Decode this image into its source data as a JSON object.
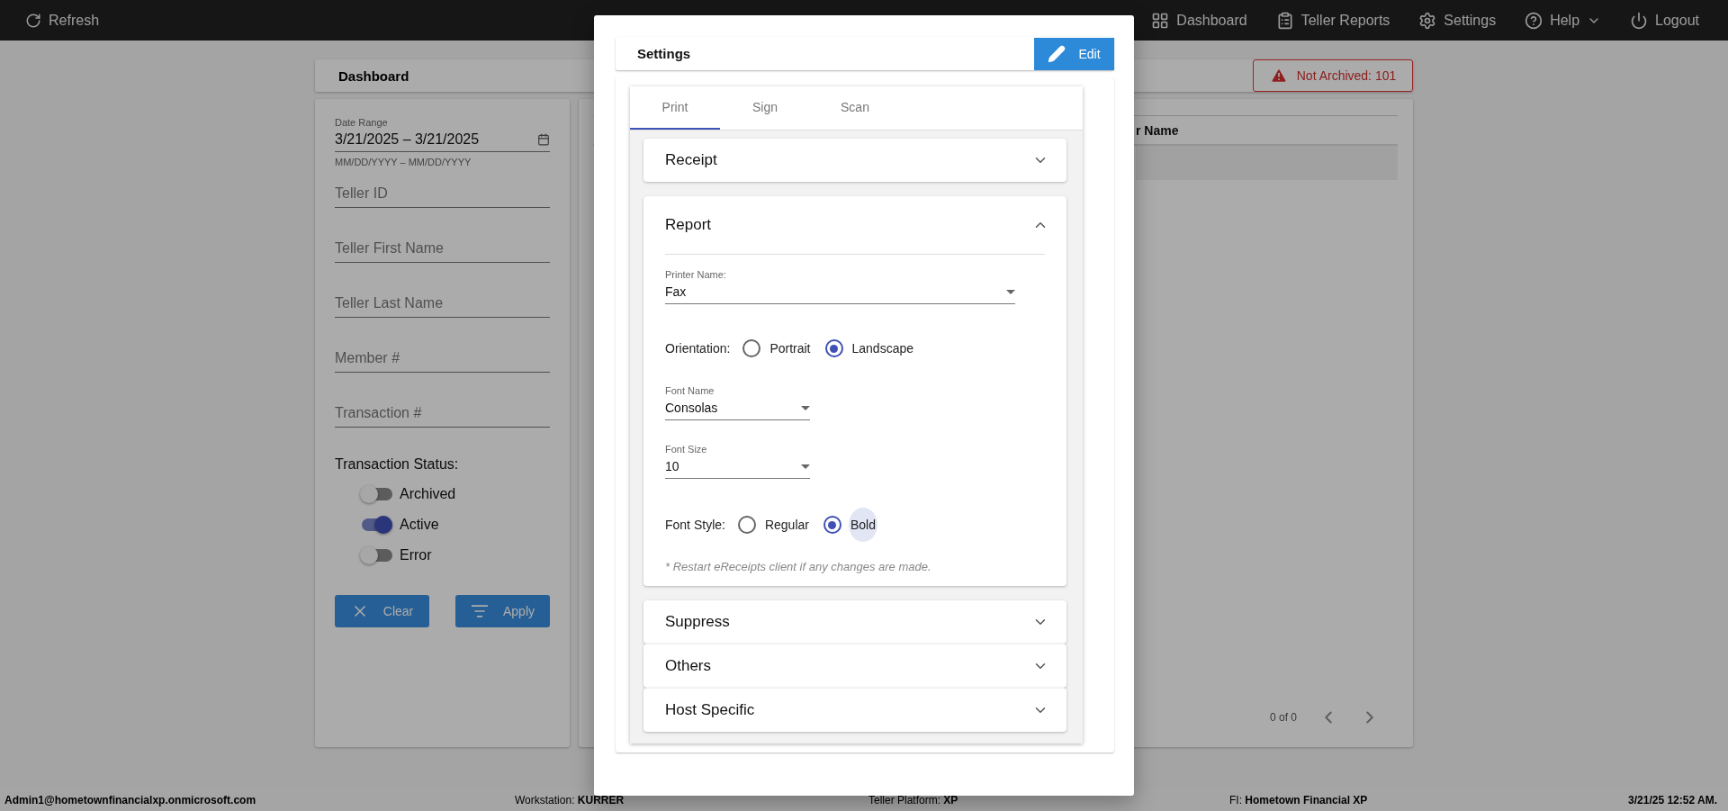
{
  "top_bar": {
    "refresh": "Refresh",
    "nav": [
      {
        "kind": "dashboard",
        "label": "Dashboard"
      },
      {
        "kind": "reports",
        "label": "Teller Reports"
      },
      {
        "kind": "settings",
        "label": "Settings"
      },
      {
        "kind": "help",
        "label": "Help"
      },
      {
        "kind": "logout",
        "label": "Logout"
      }
    ]
  },
  "page": {
    "title": "Dashboard",
    "alert": "Not Archived: 101"
  },
  "filters": {
    "date_range": {
      "label": "Date Range",
      "value": "3/21/2025 – 3/21/2025",
      "helper": "MM/DD/YYYY – MM/DD/YYYY"
    },
    "fields": [
      {
        "placeholder": "Teller ID"
      },
      {
        "placeholder": "Teller First Name"
      },
      {
        "placeholder": "Teller Last Name"
      },
      {
        "placeholder": "Member #"
      },
      {
        "placeholder": "Transaction #"
      }
    ],
    "status_label": "Transaction Status:",
    "toggles": [
      {
        "label": "Archived",
        "on": false
      },
      {
        "label": "Active",
        "on": true
      },
      {
        "label": "Error",
        "on": false
      }
    ],
    "buttons": [
      {
        "kind": "clear",
        "label": "Clear"
      },
      {
        "kind": "apply",
        "label": "Apply"
      }
    ]
  },
  "table": {
    "column_2": "r Name",
    "pagination": "0 of 0"
  },
  "modal": {
    "title": "Settings",
    "edit": "Edit",
    "tabs": [
      {
        "label": "Print",
        "selected": true
      },
      {
        "label": "Sign",
        "selected": false
      },
      {
        "label": "Scan",
        "selected": false
      }
    ],
    "sections": [
      {
        "title": "Receipt",
        "expanded": false
      },
      {
        "title": "Report",
        "expanded": true,
        "printer": {
          "label": "Printer Name:",
          "value": "Fax"
        },
        "orientation": {
          "label": "Orientation:",
          "options": [
            {
              "label": "Portrait",
              "selected": false,
              "focused": false
            },
            {
              "label": "Landscape",
              "selected": true,
              "focused": false
            }
          ]
        },
        "font_name": {
          "label": "Font Name",
          "value": "Consolas"
        },
        "font_size": {
          "label": "Font Size",
          "value": "10"
        },
        "font_style": {
          "label": "Font Style:",
          "options": [
            {
              "label": "Regular",
              "selected": false,
              "focused": false
            },
            {
              "label": "Bold",
              "selected": true,
              "focused": true
            }
          ]
        },
        "note": "* Restart eReceipts client if any changes are made."
      },
      {
        "title": "Suppress",
        "expanded": false
      },
      {
        "title": "Others",
        "expanded": false
      },
      {
        "title": "Host Specific",
        "expanded": false
      }
    ]
  },
  "status_bar": [
    "**Admin1@hometownfinancialxp.onmicrosoft.com**",
    "Workstation: **KURRER**",
    "Teller Platform: **XP**",
    "FI: **Hometown Financial XP**",
    "**3/21/25 12:52 AM.**"
  ]
}
